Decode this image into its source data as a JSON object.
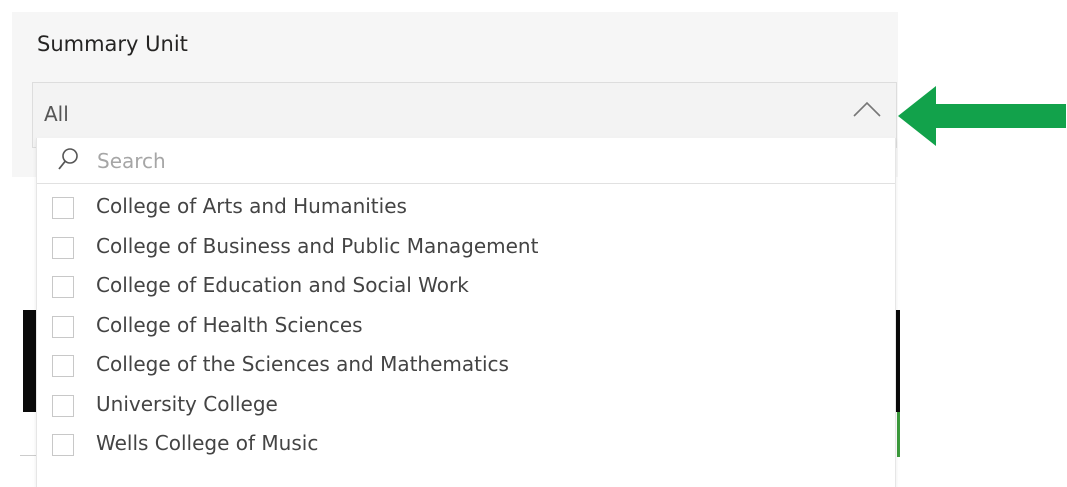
{
  "slicer": {
    "title": "Summary Unit",
    "selected_value": "All",
    "search_placeholder": "Search",
    "options": [
      "College of Arts and Humanities",
      "College of Business and Public Management",
      "College of Education and Social Work",
      "College of Health Sciences",
      "College of the Sciences and Mathematics",
      "University College",
      "Wells College of Music"
    ]
  },
  "icons": {
    "dropdown_toggle": "chevron-up-icon",
    "search": "search-icon",
    "annotation": "arrow-left-icon"
  },
  "colors": {
    "annotation_arrow": "#12a24b",
    "checkbox_border": "#c8c8c8",
    "text": "#444444"
  }
}
